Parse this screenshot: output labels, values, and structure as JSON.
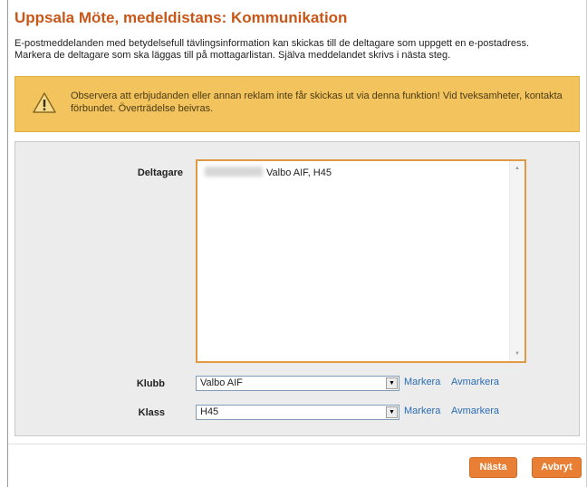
{
  "page": {
    "title": "Uppsala Möte, medeldistans: Kommunikation",
    "intro_line1": "E-postmeddelanden med betydelsefull tävlingsinformation kan skickas till de deltagare som uppgett en e-postadress.",
    "intro_line2": "Markera de deltagare som ska läggas till på mottagarlistan. Själva meddelandet skrivs i nästa steg."
  },
  "warning": {
    "icon": "warning-icon",
    "text": "Observera att erbjudanden eller annan reklam inte får skickas ut via denna funktion! Vid tveksamheter, kontakta förbundet. Överträdelse beivras."
  },
  "form": {
    "participants_label": "Deltagare",
    "participants": [
      {
        "detail": "Valbo AIF, H45"
      }
    ],
    "club_label": "Klubb",
    "club_value": "Valbo AIF",
    "class_label": "Klass",
    "class_value": "H45",
    "select_label": "Markera",
    "deselect_label": "Avmarkera"
  },
  "buttons": {
    "next": "Nästa",
    "cancel": "Avbryt"
  },
  "colors": {
    "title": "#c8571a",
    "warning_bg": "#f3c45d",
    "button_bg": "#e87f34",
    "link": "#2a6cb5",
    "listbox_border": "#e09a46"
  }
}
